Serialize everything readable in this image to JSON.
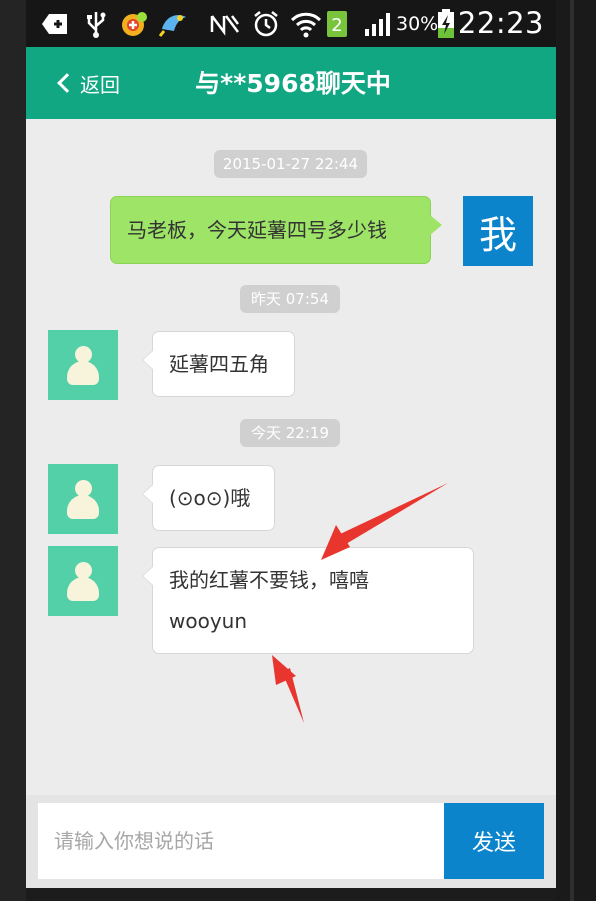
{
  "status_bar": {
    "icons": [
      "notification-plus-icon",
      "usb-icon",
      "app-badge-icon",
      "bird-app-icon",
      "mute-icon",
      "alarm-icon",
      "wifi-icon",
      "sim-2-icon",
      "signal-icon",
      "battery-charging-icon"
    ],
    "sim_label": "2",
    "battery_percent": "30%",
    "time": "22:23"
  },
  "header": {
    "back_label": "返回",
    "title": "与**5968聊天中",
    "color": "#12a783"
  },
  "chat": {
    "messages": [
      {
        "type": "timestamp",
        "text": "2015-01-27 22:44"
      },
      {
        "type": "message",
        "from": "me",
        "text": "马老板，今天延薯四号多少钱",
        "avatar_text": "我"
      },
      {
        "type": "timestamp",
        "text": "昨天 07:54"
      },
      {
        "type": "message",
        "from": "other",
        "text": "延薯四五角"
      },
      {
        "type": "timestamp",
        "text": "今天 22:19"
      },
      {
        "type": "message",
        "from": "other",
        "text": "(⊙o⊙)哦"
      },
      {
        "type": "message",
        "from": "other",
        "lines": [
          "我的红薯不要钱，嘻嘻",
          "wooyun"
        ]
      }
    ],
    "annotation_color": "#e8352e"
  },
  "input": {
    "placeholder": "请输入你想说的话",
    "value": "",
    "send_label": "发送"
  },
  "colors": {
    "accent": "#12a783",
    "me_bubble": "#9de467",
    "send_button": "#0b84cc",
    "avatar_other": "#53d0a7"
  }
}
